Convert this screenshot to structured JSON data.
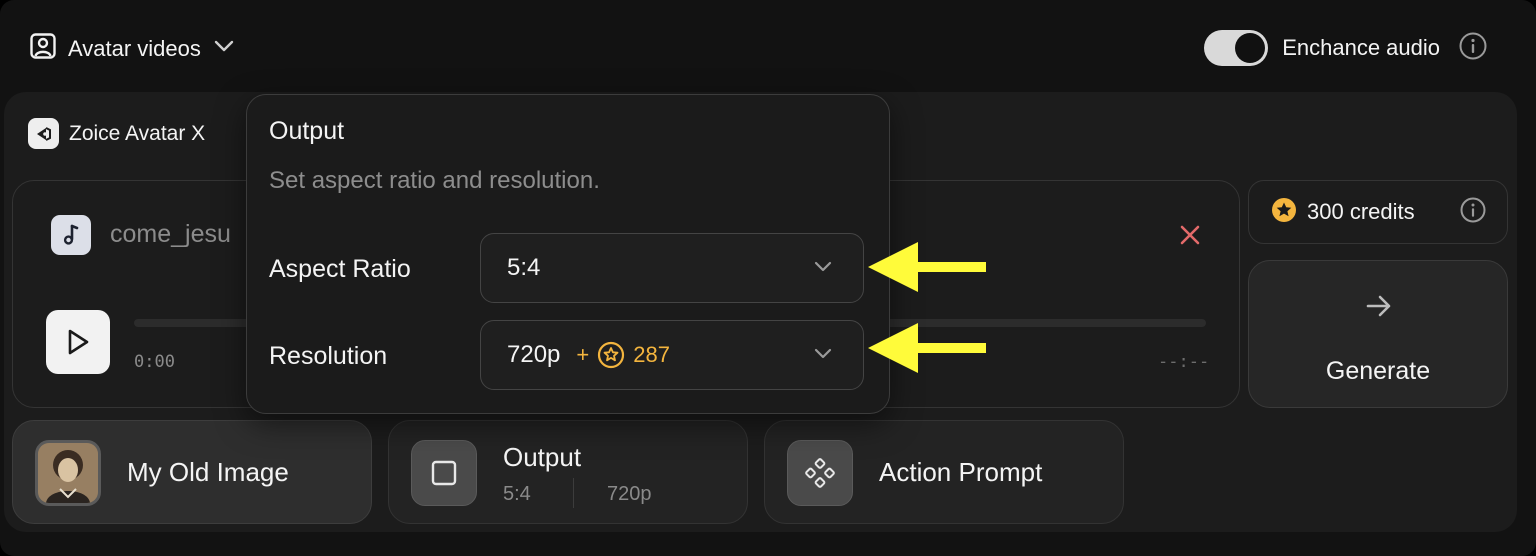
{
  "header": {
    "mode_label": "Avatar videos",
    "enhance_audio_label": "Enchance audio",
    "enhance_audio_enabled": true
  },
  "model": {
    "label": "Zoice Avatar X"
  },
  "audio": {
    "file_name": "come_jesu",
    "time_current": "0:00",
    "time_total": "--:--"
  },
  "credits": {
    "label": "300 credits"
  },
  "generate": {
    "label": "Generate"
  },
  "cards": {
    "image": {
      "label": "My Old Image"
    },
    "output": {
      "label": "Output",
      "aspect": "5:4",
      "resolution": "720p"
    },
    "action": {
      "label": "Action Prompt"
    }
  },
  "popover": {
    "title": "Output",
    "description": "Set aspect ratio and resolution.",
    "aspect_label": "Aspect Ratio",
    "aspect_value": "5:4",
    "resolution_label": "Resolution",
    "resolution_value": "720p",
    "resolution_plus": "+",
    "resolution_cost": "287"
  },
  "colors": {
    "accent_yellow": "#f4b53e",
    "annotation_arrow": "#fffb3a",
    "close_red": "#e36a6a"
  }
}
